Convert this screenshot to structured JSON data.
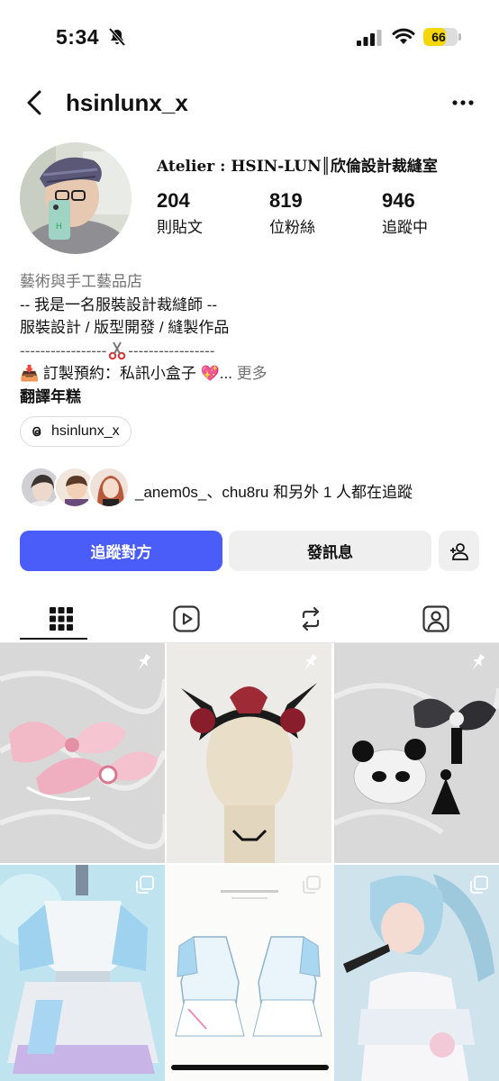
{
  "status_bar": {
    "time": "5:34",
    "battery": "66",
    "battery_level": 0.66
  },
  "header": {
    "username": "hsinlunx_x",
    "back_icon": "chevron-left-icon",
    "more_icon": "ellipsis-icon"
  },
  "profile": {
    "name": "Atelier : HSIN-LUN║欣倫設計裁縫室",
    "stats": [
      {
        "value": "204",
        "label": "則貼文"
      },
      {
        "value": "819",
        "label": "位粉絲"
      },
      {
        "value": "946",
        "label": "追蹤中"
      }
    ]
  },
  "bio": {
    "category": "藝術與手工藝品店",
    "line1": "-- 我是一名服裝設計裁縫師 --",
    "line2": "服裝設計 / 版型開發 / 縫製作品",
    "divider_left": "-----------------",
    "divider_right": "-----------------",
    "reservation": "📥 訂製預約：私訊小盒子 💖...",
    "more": "更多",
    "translate": "翻譯年糕"
  },
  "threads": {
    "handle": "hsinlunx_x"
  },
  "followed_by": {
    "text": "_anem0s_、chu8ru 和另外 1 人都在追蹤"
  },
  "buttons": {
    "follow": "追蹤對方",
    "message": "發訊息",
    "add_user_icon": "add-user-icon"
  },
  "tabs": [
    "grid-icon",
    "reels-icon",
    "reposts-icon",
    "tagged-icon"
  ],
  "colors": {
    "follow_button": "#4a5df9",
    "secondary_button": "#efefef",
    "battery": "#f5d60b"
  }
}
